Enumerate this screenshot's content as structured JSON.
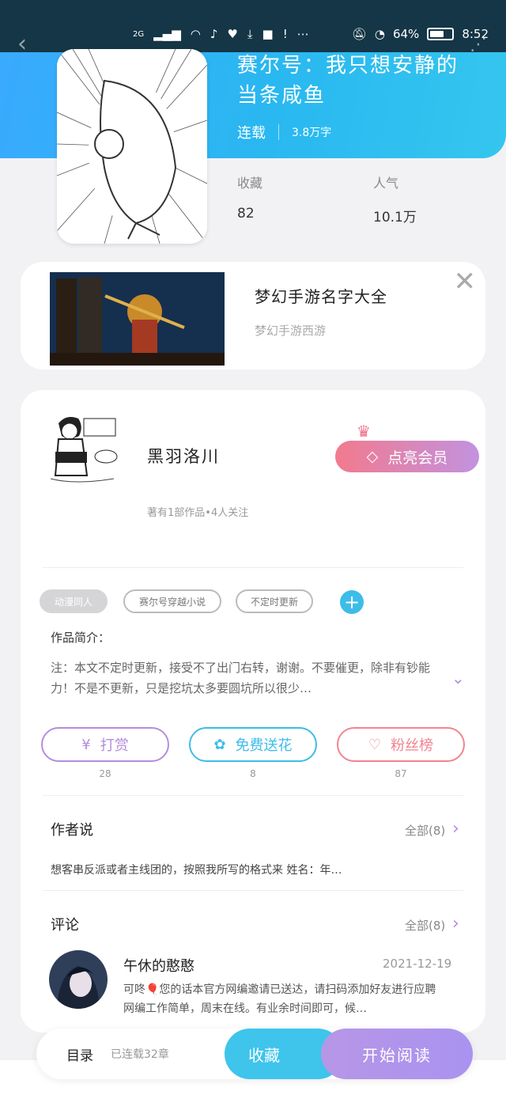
{
  "status_bar": {
    "network": "2G",
    "battery": "64%",
    "time": "8:52",
    "battery_level": 0.64
  },
  "book": {
    "title": "赛尔号：我只想安静的当条咸鱼",
    "status": "连载",
    "word_count": "3.8万字",
    "stats": {
      "favorites_label": "收藏",
      "favorites_value": "82",
      "popularity_label": "人气",
      "popularity_value": "10.1万"
    }
  },
  "ad": {
    "title": "梦幻手游名字大全",
    "subtitle": "梦幻手游西游"
  },
  "author": {
    "name": "黑羽洛川",
    "info": "著有1部作品•4人关注",
    "vip_label": "点亮会员"
  },
  "tags": [
    "动漫同人",
    "赛尔号穿越小说",
    "不定时更新"
  ],
  "intro": {
    "heading": "作品简介：",
    "text": "注：本文不定时更新，接受不了出门右转，谢谢。不要催更，除非有钞能力！不是不更新，只是挖坑太多要圆坑所以很少…"
  },
  "actions": [
    {
      "label": "打赏",
      "count": "28",
      "color": "#b58ddc",
      "icon": "yuan-icon"
    },
    {
      "label": "免费送花",
      "count": "8",
      "color": "#3cbde9",
      "icon": "flower-icon"
    },
    {
      "label": "粉丝榜",
      "count": "87",
      "color": "#f2848f",
      "icon": "fans-icon"
    }
  ],
  "author_says": {
    "heading": "作者说",
    "all": "全部(8)",
    "text": "想客串反派或者主线团的，按照我所写的格式来 姓名：年…"
  },
  "comments": {
    "heading": "评论",
    "all": "全部(8)",
    "items": [
      {
        "user": "午休的憨憨",
        "date": "2021-12-19",
        "text": "可咚🎈您的话本官方网编邀请已送达，请扫码添加好友进行应聘 网编工作简单，周末在线。有业余时间即可，候…"
      }
    ]
  },
  "bottom": {
    "toc": "目录",
    "chapters": "已连载32章",
    "favorite": "收藏",
    "read": "开始阅读"
  },
  "colors": {
    "header_blue": "#3aa9ff",
    "accent_cyan": "#3cbde9",
    "accent_purple": "#b796e6",
    "vip_pink": "#f27a8e"
  }
}
